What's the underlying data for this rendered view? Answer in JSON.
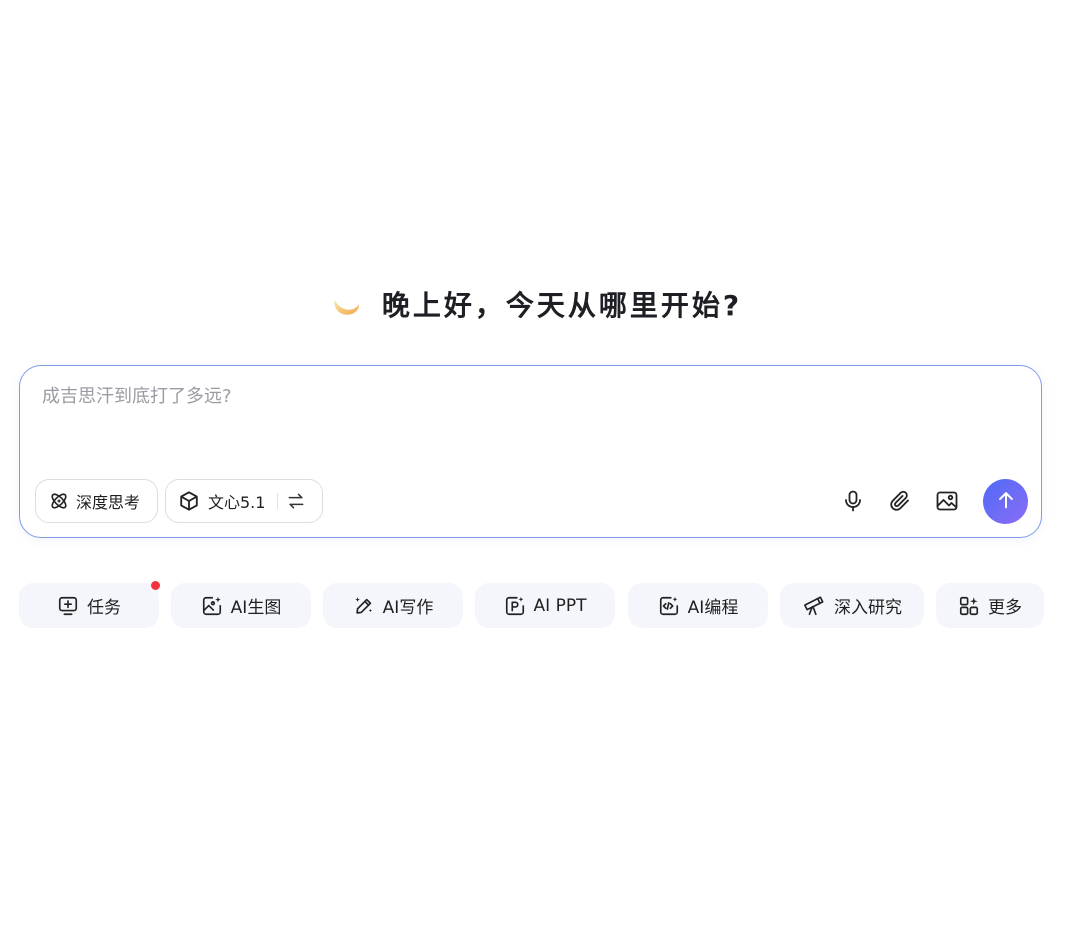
{
  "greeting": {
    "icon": "crescent-moon-icon",
    "text": "晚上好，今天从哪里开始?"
  },
  "composer": {
    "placeholder": "成吉思汗到底打了多远?",
    "deep_think_label": "深度思考",
    "model_label": "文心5.1",
    "tools": [
      "microphone-icon",
      "paperclip-icon",
      "image-icon"
    ],
    "send_icon": "arrow-up-icon",
    "accent_color": "#5b6cf6"
  },
  "quick_actions": [
    {
      "label": "任务",
      "icon": "task-icon",
      "badge": true
    },
    {
      "label": "AI生图",
      "icon": "image-gen-icon"
    },
    {
      "label": "AI写作",
      "icon": "pen-sparkle-icon"
    },
    {
      "label": "AI PPT",
      "icon": "ppt-icon"
    },
    {
      "label": "AI编程",
      "icon": "code-icon"
    },
    {
      "label": "深入研究",
      "icon": "telescope-icon"
    },
    {
      "label": "更多",
      "icon": "apps-grid-icon"
    }
  ]
}
